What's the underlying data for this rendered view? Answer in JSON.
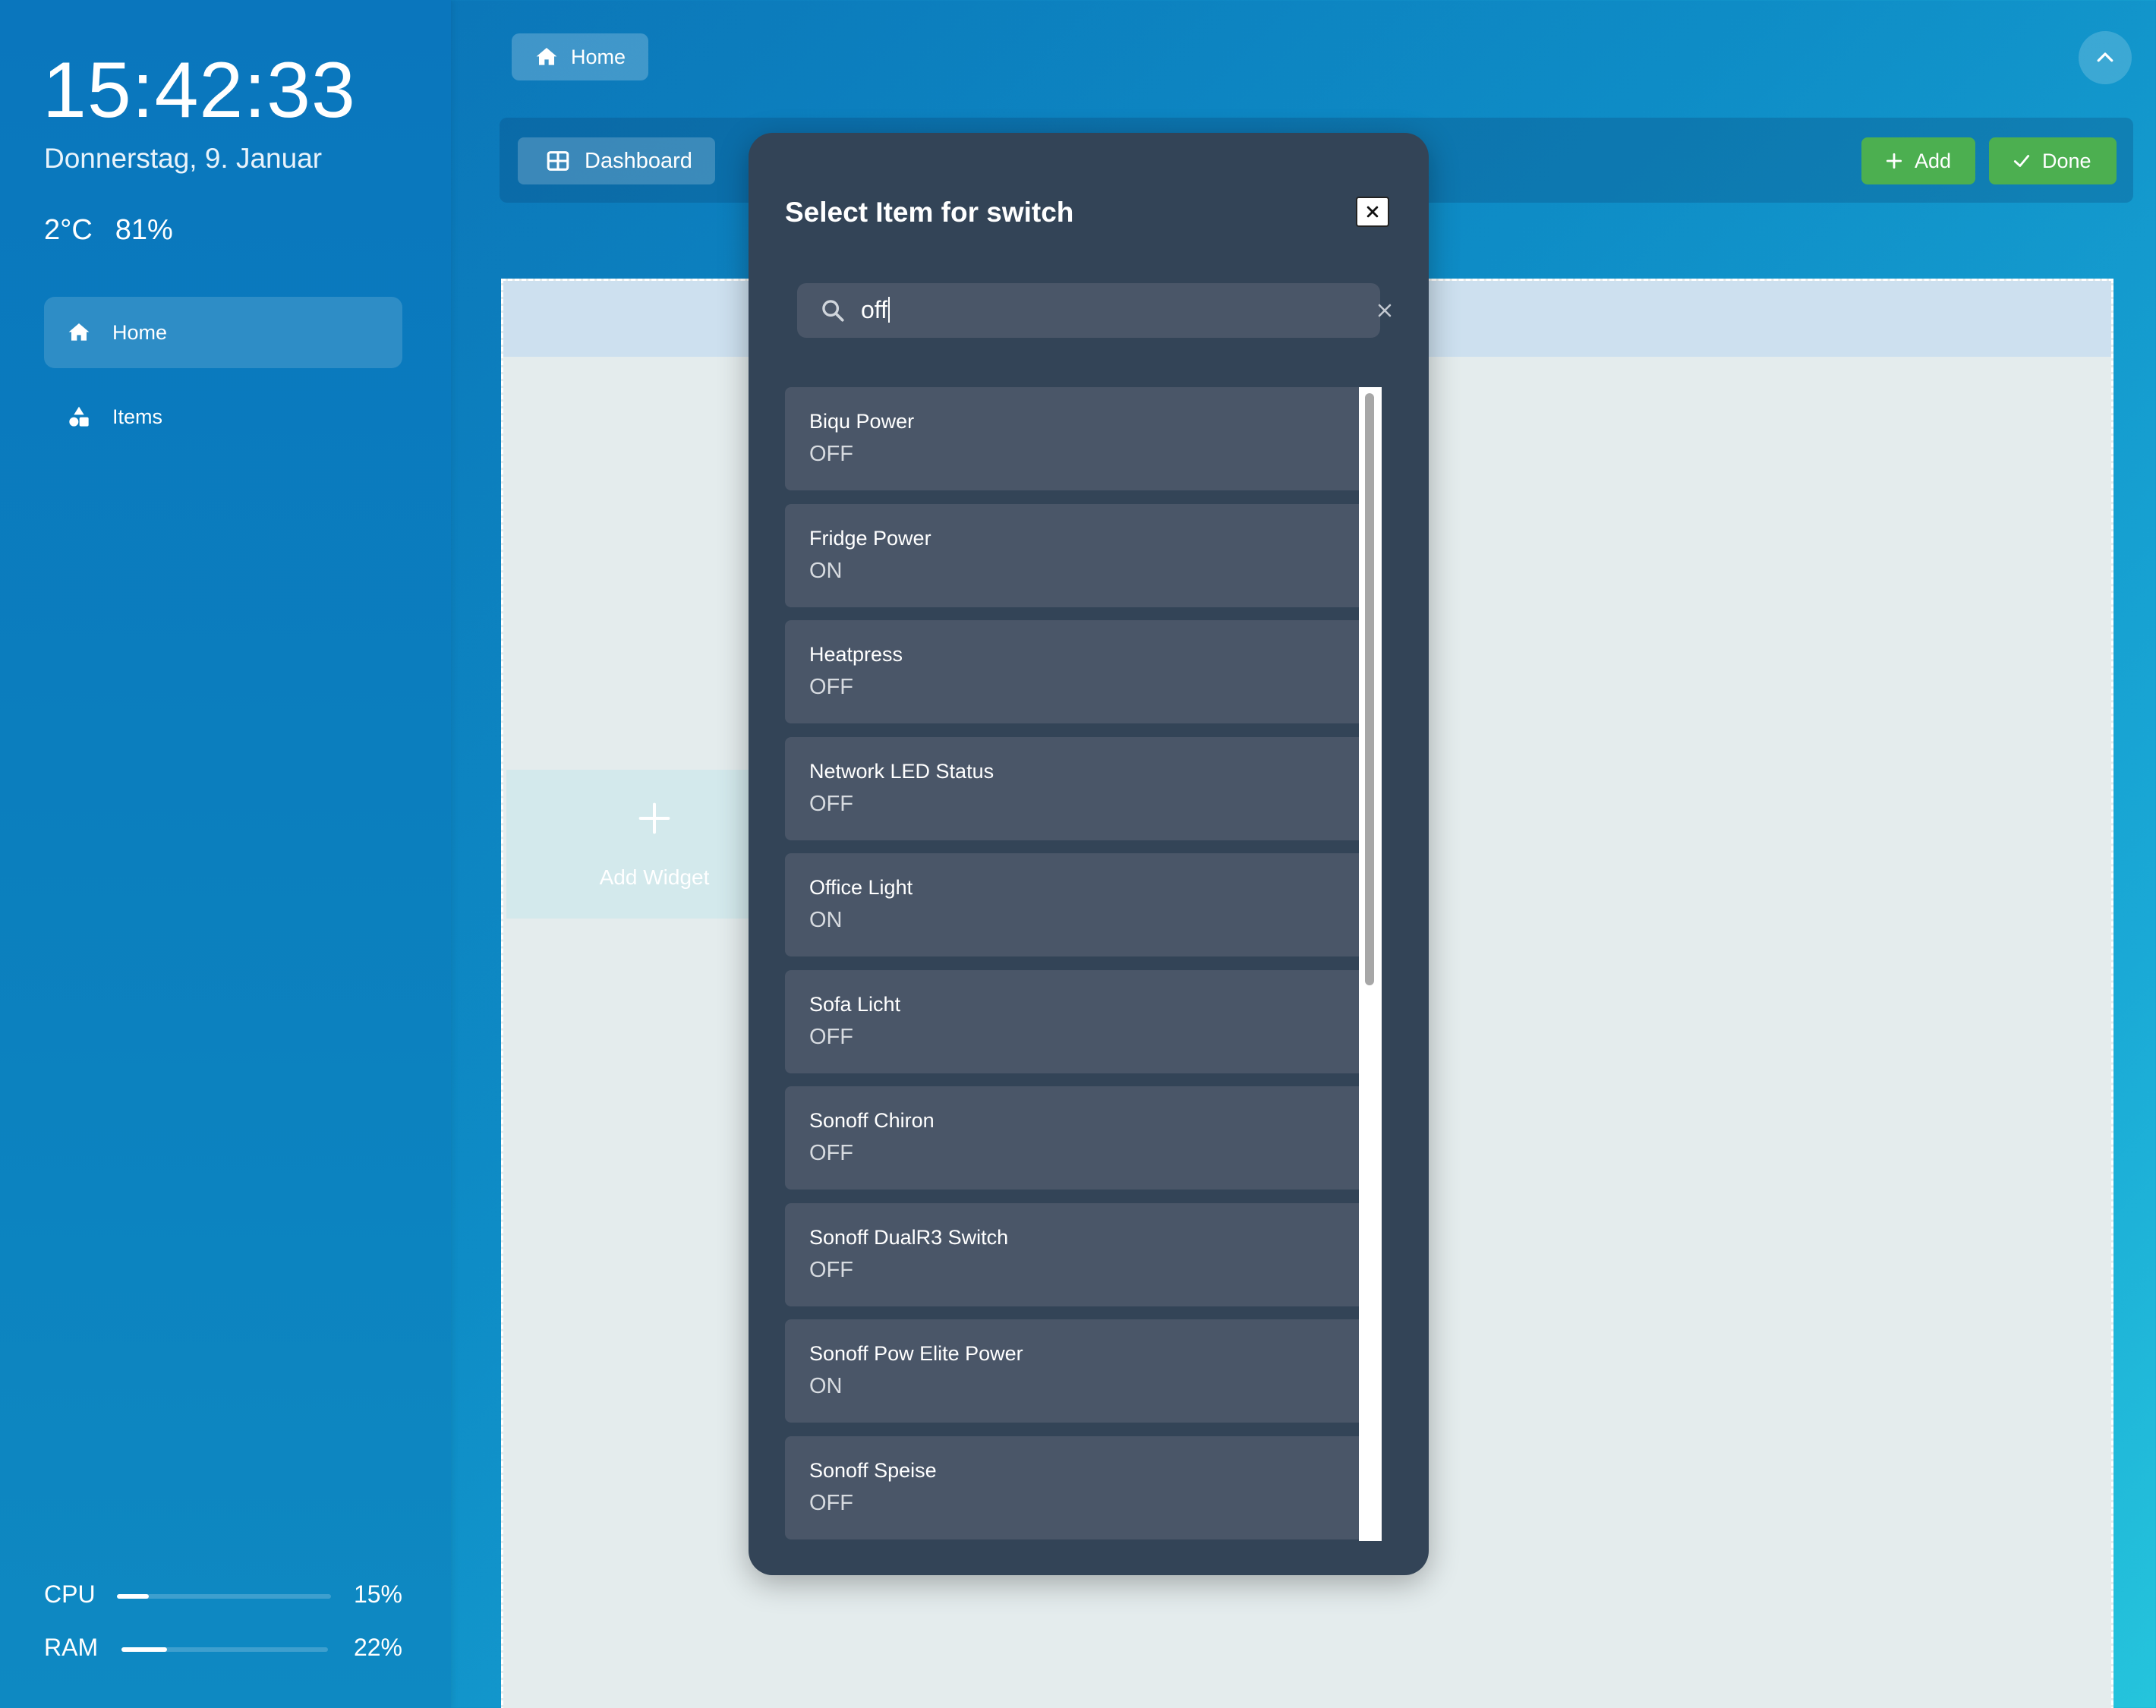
{
  "sidebar": {
    "clock": "15:42:33",
    "date": "Donnerstag, 9. Januar",
    "temperature": "2°C",
    "humidity": "81%",
    "nav": [
      {
        "label": "Home",
        "icon": "home-icon",
        "active": true
      },
      {
        "label": "Items",
        "icon": "items-icon",
        "active": false
      }
    ],
    "stats": {
      "cpu": {
        "label": "CPU",
        "value": "15%",
        "fraction": 0.15
      },
      "ram": {
        "label": "RAM",
        "value": "22%",
        "fraction": 0.22
      }
    }
  },
  "topbar": {
    "home_label": "Home",
    "collapse_icon": "chevron-up-icon"
  },
  "toolbar": {
    "dashboard_label": "Dashboard",
    "add_label": "Add",
    "done_label": "Done"
  },
  "canvas": {
    "add_widget_label": "Add Widget"
  },
  "modal": {
    "title": "Select Item for switch",
    "close_symbol": "×",
    "search": {
      "value": "off"
    },
    "items": [
      {
        "name": "Biqu Power",
        "state": "OFF"
      },
      {
        "name": "Fridge Power",
        "state": "ON"
      },
      {
        "name": "Heatpress",
        "state": "OFF"
      },
      {
        "name": "Network LED Status",
        "state": "OFF"
      },
      {
        "name": "Office Light",
        "state": "ON"
      },
      {
        "name": "Sofa Licht",
        "state": "OFF"
      },
      {
        "name": "Sonoff Chiron",
        "state": "OFF"
      },
      {
        "name": "Sonoff DualR3 Switch",
        "state": "OFF"
      },
      {
        "name": "Sonoff Pow Elite Power",
        "state": "ON"
      },
      {
        "name": "Sonoff Speise",
        "state": "OFF"
      }
    ]
  },
  "colors": {
    "accent_green": "#4caf50",
    "modal_bg": "#334457",
    "item_bg": "#4a5668"
  }
}
